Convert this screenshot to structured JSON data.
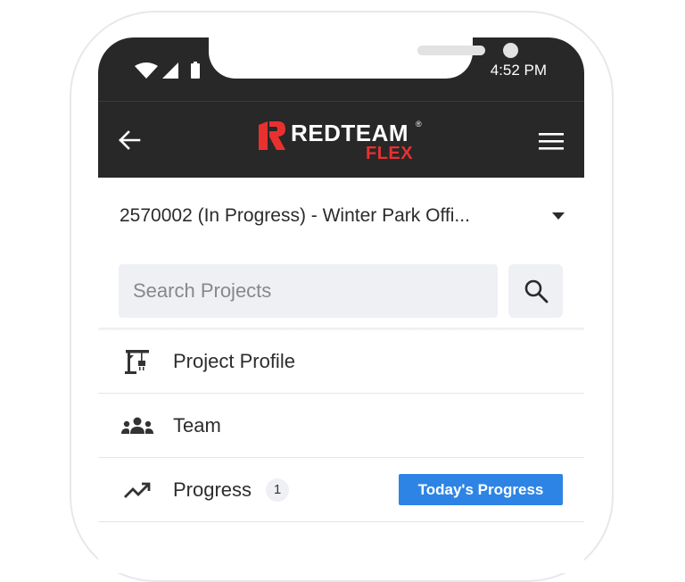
{
  "status_bar": {
    "time": "4:52 PM"
  },
  "header": {
    "logo_text": "REDTEAM",
    "logo_reg": "®",
    "logo_sub": "FLEX",
    "back_icon": "arrow-left-icon",
    "menu_icon": "hamburger-menu-icon"
  },
  "project_selector": {
    "selected": "2570002 (In Progress) - Winter Park Offi...",
    "caret_icon": "caret-down-icon"
  },
  "search": {
    "placeholder": "Search Projects",
    "icon": "search-icon"
  },
  "menu": {
    "items": [
      {
        "label": "Project Profile",
        "icon": "crane-icon"
      },
      {
        "label": "Team",
        "icon": "team-icon"
      },
      {
        "label": "Progress",
        "icon": "trending-up-icon",
        "count": "1",
        "action": "Today's Progress"
      }
    ]
  },
  "colors": {
    "header_bg": "#282828",
    "brand_red": "#e8312f",
    "accent_blue": "#2d84e5"
  }
}
